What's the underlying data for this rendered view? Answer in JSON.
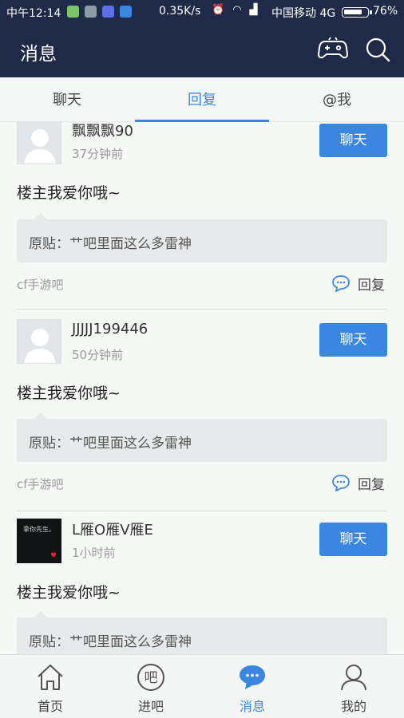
{
  "status_bar": {
    "time": "中午12:14",
    "speed": "0.35K/s",
    "carrier": "中国移动 4G",
    "battery": "76%",
    "app_icon_colors": [
      "#7cc36a",
      "#8e9aa4",
      "#5b6fe8",
      "#3a86e0"
    ]
  },
  "header": {
    "title": "消息",
    "icons": [
      "gamepad-icon",
      "search-icon"
    ]
  },
  "tabs": [
    {
      "label": "聊天",
      "active": false
    },
    {
      "label": "回复",
      "active": true
    },
    {
      "label": "@我",
      "active": false
    }
  ],
  "replies": [
    {
      "username": "飘飘飘90",
      "time": "37分钟前",
      "chat_label": "聊天",
      "message": "楼主我爱你哦~",
      "original_post": "原贴：艹吧里面这么多雷神",
      "forum": "cf手游吧",
      "reply_label": "回复",
      "avatar": "default"
    },
    {
      "username": "JJJJJ199446",
      "time": "50分钟前",
      "chat_label": "聊天",
      "message": "楼主我爱你哦~",
      "original_post": "原贴：艹吧里面这么多雷神",
      "forum": "cf手游吧",
      "reply_label": "回复",
      "avatar": "default"
    },
    {
      "username": "L雁O雁V雁E",
      "time": "1小时前",
      "chat_label": "聊天",
      "message": "楼主我爱你哦~",
      "original_post": "原贴：艹吧里面这么多雷神",
      "avatar": "photo",
      "avatar_text": "拿你先生。"
    }
  ],
  "bottom_nav": [
    {
      "label": "首页",
      "icon": "home-icon",
      "active": false
    },
    {
      "label": "进吧",
      "icon": "forum-icon",
      "active": false
    },
    {
      "label": "消息",
      "icon": "message-icon",
      "active": true
    },
    {
      "label": "我的",
      "icon": "profile-icon",
      "active": false
    }
  ],
  "colors": {
    "header_bg": "#1e2a47",
    "accent": "#3a86e0",
    "page_bg": "#f6f8f6"
  }
}
